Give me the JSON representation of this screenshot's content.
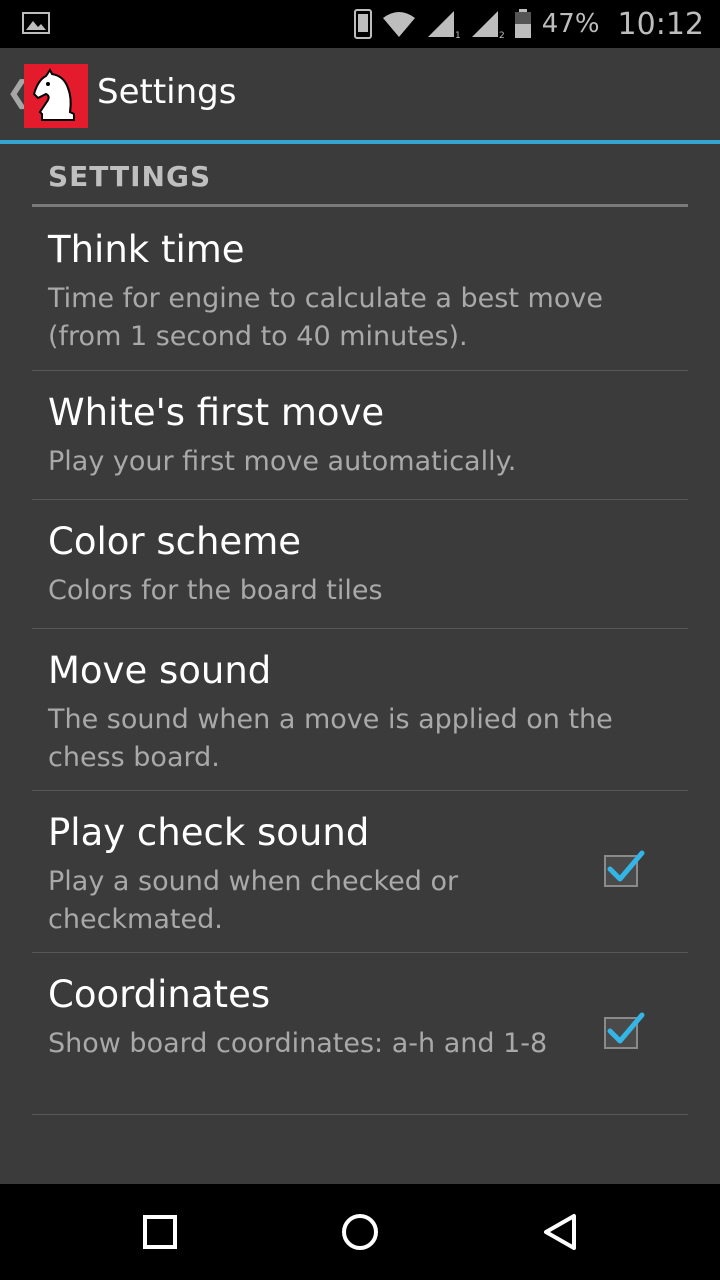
{
  "status_bar": {
    "battery_percent": "47%",
    "time": "10:12",
    "icons": [
      "image-icon",
      "phone-icon",
      "wifi-icon",
      "signal-1-icon",
      "signal-2-icon",
      "battery-icon"
    ]
  },
  "action_bar": {
    "title": "Settings",
    "back_icon": "chevron-left-icon",
    "logo_icon": "chess-knight-icon",
    "accent_color": "#33a5cf",
    "logo_color": "#e31b2c"
  },
  "category": {
    "label": "SETTINGS"
  },
  "preferences": [
    {
      "title": "Think time",
      "summary": "Time for engine to calculate a best move (from 1 second to 40 minutes)."
    },
    {
      "title": "White's first move",
      "summary": "Play your first move automatically."
    },
    {
      "title": "Color scheme",
      "summary": "Colors for the board tiles"
    },
    {
      "title": "Move sound",
      "summary": "The sound when a move is applied on the chess board."
    },
    {
      "title": "Play check sound",
      "summary": "Play a sound when checked or checkmated.",
      "checked": true
    },
    {
      "title": "Coordinates",
      "summary": "Show board coordinates: a-h and 1-8",
      "checked": true
    }
  ],
  "nav_bar": {
    "icons": [
      "recents-square-icon",
      "home-circle-icon",
      "back-triangle-icon"
    ]
  }
}
